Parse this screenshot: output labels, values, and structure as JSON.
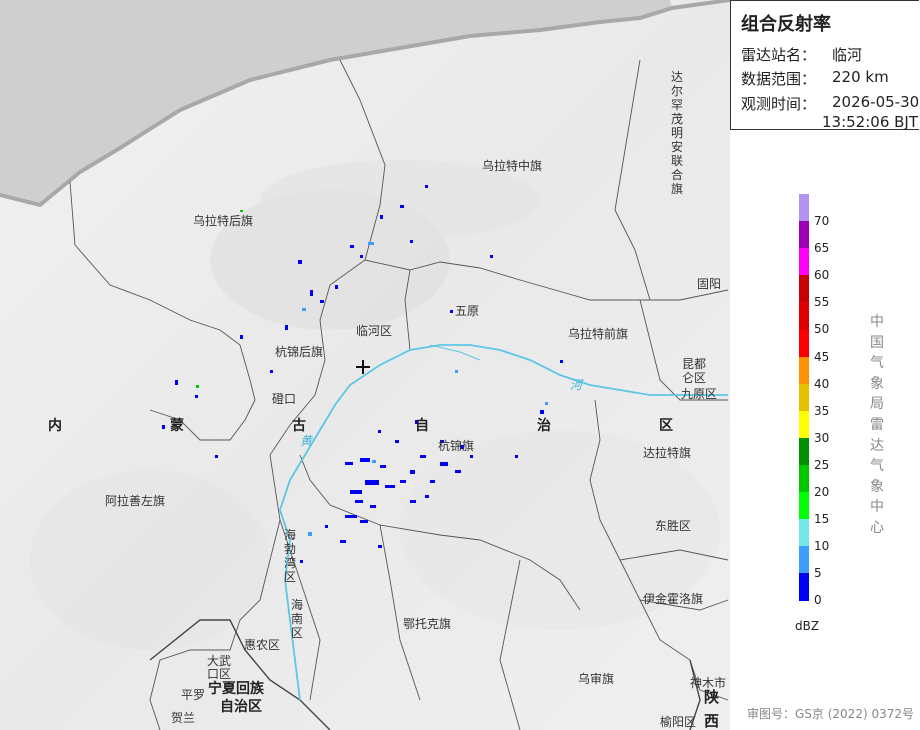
{
  "product": {
    "title": "组合反射率",
    "station_label": "雷达站名：",
    "station_value": "临河",
    "range_label": "数据范围：",
    "range_value": "220 km",
    "time_label": "观测时间：",
    "time_date": "2026-05-30",
    "time_clock": "13:52:06 BJT"
  },
  "legend": {
    "unit": "dBZ",
    "labels": [
      "70",
      "65",
      "60",
      "55",
      "50",
      "45",
      "40",
      "35",
      "30",
      "25",
      "20",
      "15",
      "10",
      "5",
      "0"
    ],
    "colors": [
      "#b293f0",
      "#a000b4",
      "#ff00ff",
      "#c80000",
      "#e10000",
      "#ff0000",
      "#ff9100",
      "#e7c000",
      "#ffff00",
      "#009000",
      "#00c800",
      "#00ff00",
      "#74e8e8",
      "#3c9dff",
      "#0000f6"
    ]
  },
  "credit": [
    "中",
    "国",
    "气",
    "象",
    "局",
    "雷",
    "达",
    "气",
    "象",
    "中",
    "心"
  ],
  "review_no": "审图号：GS京 (2022) 0372号",
  "map": {
    "places": {
      "wulatezhongqi": "乌拉特中旗",
      "wulatehouqi": "乌拉特后旗",
      "linhequ": "临河区",
      "wuyuan": "五原",
      "wulateqianqi": "乌拉特前旗",
      "hangjinhouqi": "杭锦后旗",
      "guyang": "固阳",
      "kunduqu": "昆都仑区",
      "jiuyuanqu": "九原区",
      "dengkou": "磴口",
      "hangjinqi": "杭锦旗",
      "dalateqi": "达拉特旗",
      "alashanzuoqi": "阿拉善左旗",
      "dongshengqu": "东胜区",
      "yijinhuoluoqi": "伊金霍洛旗",
      "etuokeqi": "鄂托克旗",
      "huinongqu": "惠农区",
      "wushenqi": "乌审旗",
      "shenmushi": "神木市",
      "yulinqu": "榆阳区",
      "pingluo": "平罗",
      "helan": "贺兰"
    },
    "vertical_places": {
      "darhan": "达尔罕茂明安联合旗",
      "haibowanqu": "海勃湾区",
      "hainanqu": "海南区",
      "dawukouqu": "大武口区"
    },
    "region_nei": "内",
    "region_meng": "蒙",
    "region_gu": "古",
    "region_zi": "自",
    "region_zhi": "治",
    "region_qu": "区",
    "ningxia_1": "宁夏回族",
    "ningxia_2": "自治区",
    "shaan_1": "陕",
    "shaan_2": "西",
    "river_huang": "黄",
    "river_he": "河"
  }
}
